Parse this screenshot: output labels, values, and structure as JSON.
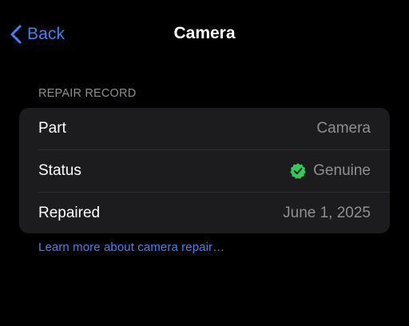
{
  "nav": {
    "back_label": "Back",
    "title": "Camera"
  },
  "section": {
    "header": "REPAIR RECORD",
    "rows": [
      {
        "label": "Part",
        "value": "Camera"
      },
      {
        "label": "Status",
        "value": "Genuine",
        "icon": "verified-checkmark-badge-icon"
      },
      {
        "label": "Repaired",
        "value": "June 1, 2025"
      }
    ]
  },
  "footer": {
    "link_label": "Learn more about camera repair…"
  },
  "colors": {
    "background": "#000000",
    "group_background": "#1c1c1e",
    "accent_blue": "#3b82f6",
    "secondary_text": "#8e8e93",
    "verified_green": "#34c759"
  }
}
